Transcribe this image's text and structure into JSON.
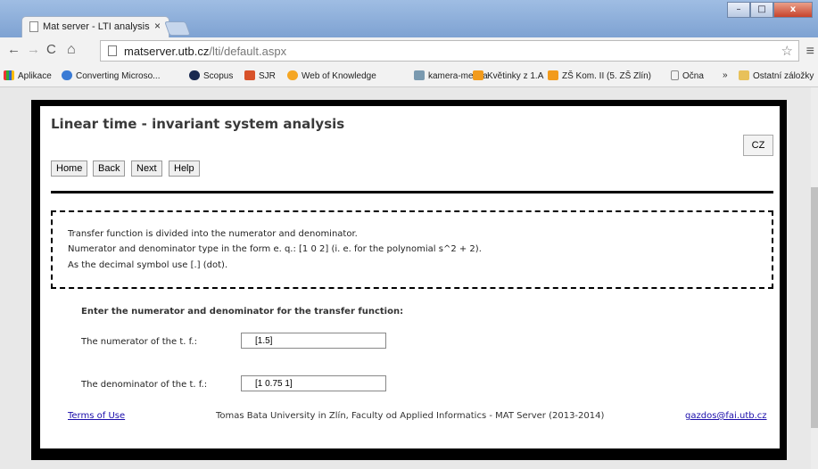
{
  "browser": {
    "tab_title": "Mat server - LTI analysis",
    "tab_close": "×",
    "url_host": "matserver.utb.cz",
    "url_path": "/lti/default.aspx",
    "min": "–",
    "max": "□",
    "close": "x"
  },
  "bookmarks": [
    {
      "label": "Aplikace"
    },
    {
      "label": "Converting Microso..."
    },
    {
      "label": "Scopus"
    },
    {
      "label": "SJR"
    },
    {
      "label": "Web of Knowledge"
    },
    {
      "label": "kamera-menza"
    },
    {
      "label": "Květinky z 1.A"
    },
    {
      "label": "ZŠ Kom. II (5. ZŠ Zlín)"
    },
    {
      "label": "Očna"
    },
    {
      "label": "»"
    },
    {
      "label": "Ostatní záložky"
    }
  ],
  "page": {
    "title": "Linear time - invariant system analysis",
    "nav": {
      "home": "Home",
      "back": "Back",
      "next": "Next",
      "help": "Help"
    },
    "lang_button": "CZ",
    "info": [
      "Transfer function is divided into the numerator and denominator.",
      "Numerator and denominator type in the form e. q.: [1 0 2] (i. e. for the polynomial s^2 + 2).",
      "As the decimal symbol use [.] (dot)."
    ],
    "form": {
      "title": "Enter the numerator and denominator for the transfer function:",
      "numerator_label": "The numerator of the t. f.:",
      "numerator_value": "[1.5]",
      "denominator_label": "The denominator of the t. f.:",
      "denominator_value": "[1 0.75 1]"
    },
    "footer": {
      "terms": "Terms of Use",
      "credit": "Tomas Bata University in Zlín, Faculty od Applied Informatics - MAT Server (2013-2014)",
      "email": "gazdos@fai.utb.cz"
    }
  },
  "colors": {
    "link": "#1a0dab",
    "frame": "#000000",
    "accent": "#4a90e2"
  }
}
